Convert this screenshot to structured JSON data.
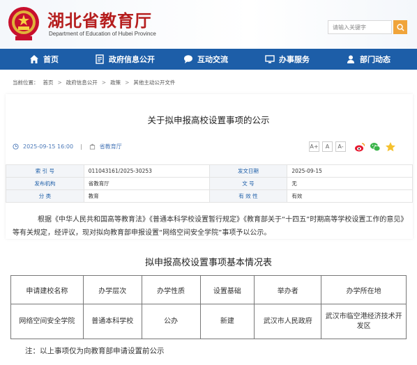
{
  "header": {
    "title": "湖北省教育厅",
    "subtitle": "Department of Education of Hubei Province",
    "search_placeholder": "请输入关键字"
  },
  "nav": {
    "items": [
      {
        "label": "首页",
        "icon": "home-icon"
      },
      {
        "label": "政府信息公开",
        "icon": "document-icon"
      },
      {
        "label": "互动交流",
        "icon": "chat-icon"
      },
      {
        "label": "办事服务",
        "icon": "monitor-icon"
      },
      {
        "label": "部门动态",
        "icon": "person-icon"
      }
    ]
  },
  "breadcrumb": {
    "prefix": "当前位置：",
    "items": [
      "首页",
      "政府信息公开",
      "政策",
      "其他主动公开文件"
    ],
    "separator": ">"
  },
  "article": {
    "title": "关于拟申报高校设置事项的公示",
    "date": "2025-09-15 16:00",
    "source": "省教育厅",
    "font_sizes": [
      "A+",
      "A",
      "A-"
    ]
  },
  "info_table": {
    "rows": [
      {
        "label1": "索 引 号",
        "value1": "011043161/2025-30253",
        "label2": "发文日期",
        "value2": "2025-09-15"
      },
      {
        "label1": "发布机构",
        "value1": "省教育厅",
        "label2": "文 号",
        "value2": "无"
      },
      {
        "label1": "分 类",
        "value1": "教育",
        "label2": "有 效 性",
        "value2": "有效"
      }
    ]
  },
  "body": {
    "paragraph": "根据《中华人民共和国高等教育法》《普通本科学校设置暂行规定》《教育部关于“十四五”时期高等学校设置工作的意见》等有关规定，经评议，现对拟向教育部申报设置“网络空间安全学院”事项予以公示。"
  },
  "summary_table": {
    "title": "拟申报高校设置事项基本情况表",
    "headers": [
      "申请建校名称",
      "办学层次",
      "办学性质",
      "设置基础",
      "举办者",
      "办学所在地"
    ],
    "rows": [
      [
        "网络空间安全学院",
        "普通本科学校",
        "公办",
        "新建",
        "武汉市人民政府",
        "武汉市临空港经济技术开发区"
      ]
    ]
  },
  "note": "注：以上事项仅为向教育部申请设置前公示",
  "colors": {
    "nav_bg": "#1d5ea8",
    "title_red": "#b51e1e",
    "search_btn": "#f0a43a"
  }
}
